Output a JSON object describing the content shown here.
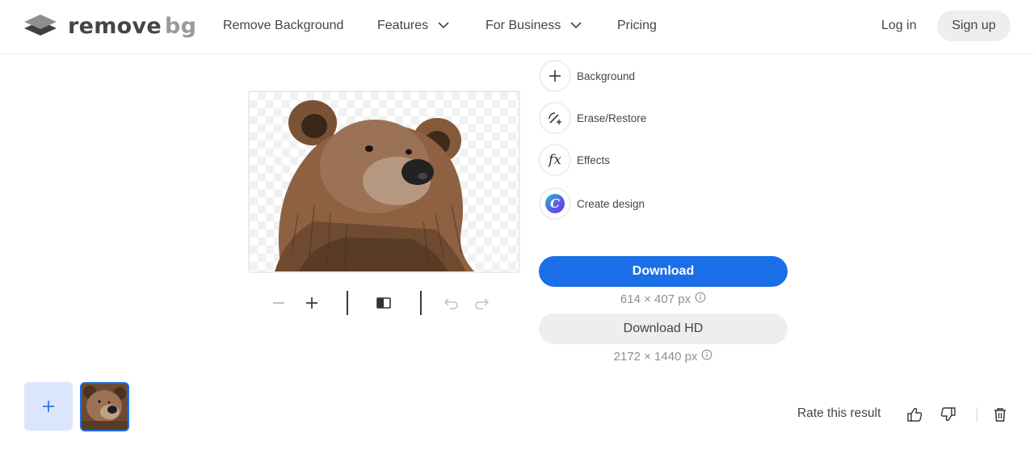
{
  "header": {
    "logo": {
      "word1": "remove",
      "word2": "bg"
    },
    "nav": [
      {
        "label": "Remove Background"
      },
      {
        "label": "Features"
      },
      {
        "label": "For Business"
      },
      {
        "label": "Pricing"
      }
    ],
    "login_label": "Log in",
    "signup_label": "Sign up"
  },
  "editor": {
    "tools": [
      {
        "label": "Background",
        "icon": "plus-icon"
      },
      {
        "label": "Erase/Restore",
        "icon": "magic-brush-icon"
      },
      {
        "label": "Effects",
        "icon": "fx-icon"
      },
      {
        "label": "Create design",
        "icon": "canva-icon"
      }
    ],
    "fx_glyph": "fx",
    "canva_glyph": "C",
    "download": {
      "label": "Download",
      "size": "614 × 407 px"
    },
    "download_hd": {
      "label": "Download HD",
      "size": "2172 × 1440 px"
    }
  },
  "rating": {
    "label": "Rate this result"
  },
  "colors": {
    "accent": "#1a6fe8",
    "text": "#454545",
    "muted": "#8a8f96",
    "button_gray": "#eceef0",
    "tile": "#dbe6fd"
  }
}
